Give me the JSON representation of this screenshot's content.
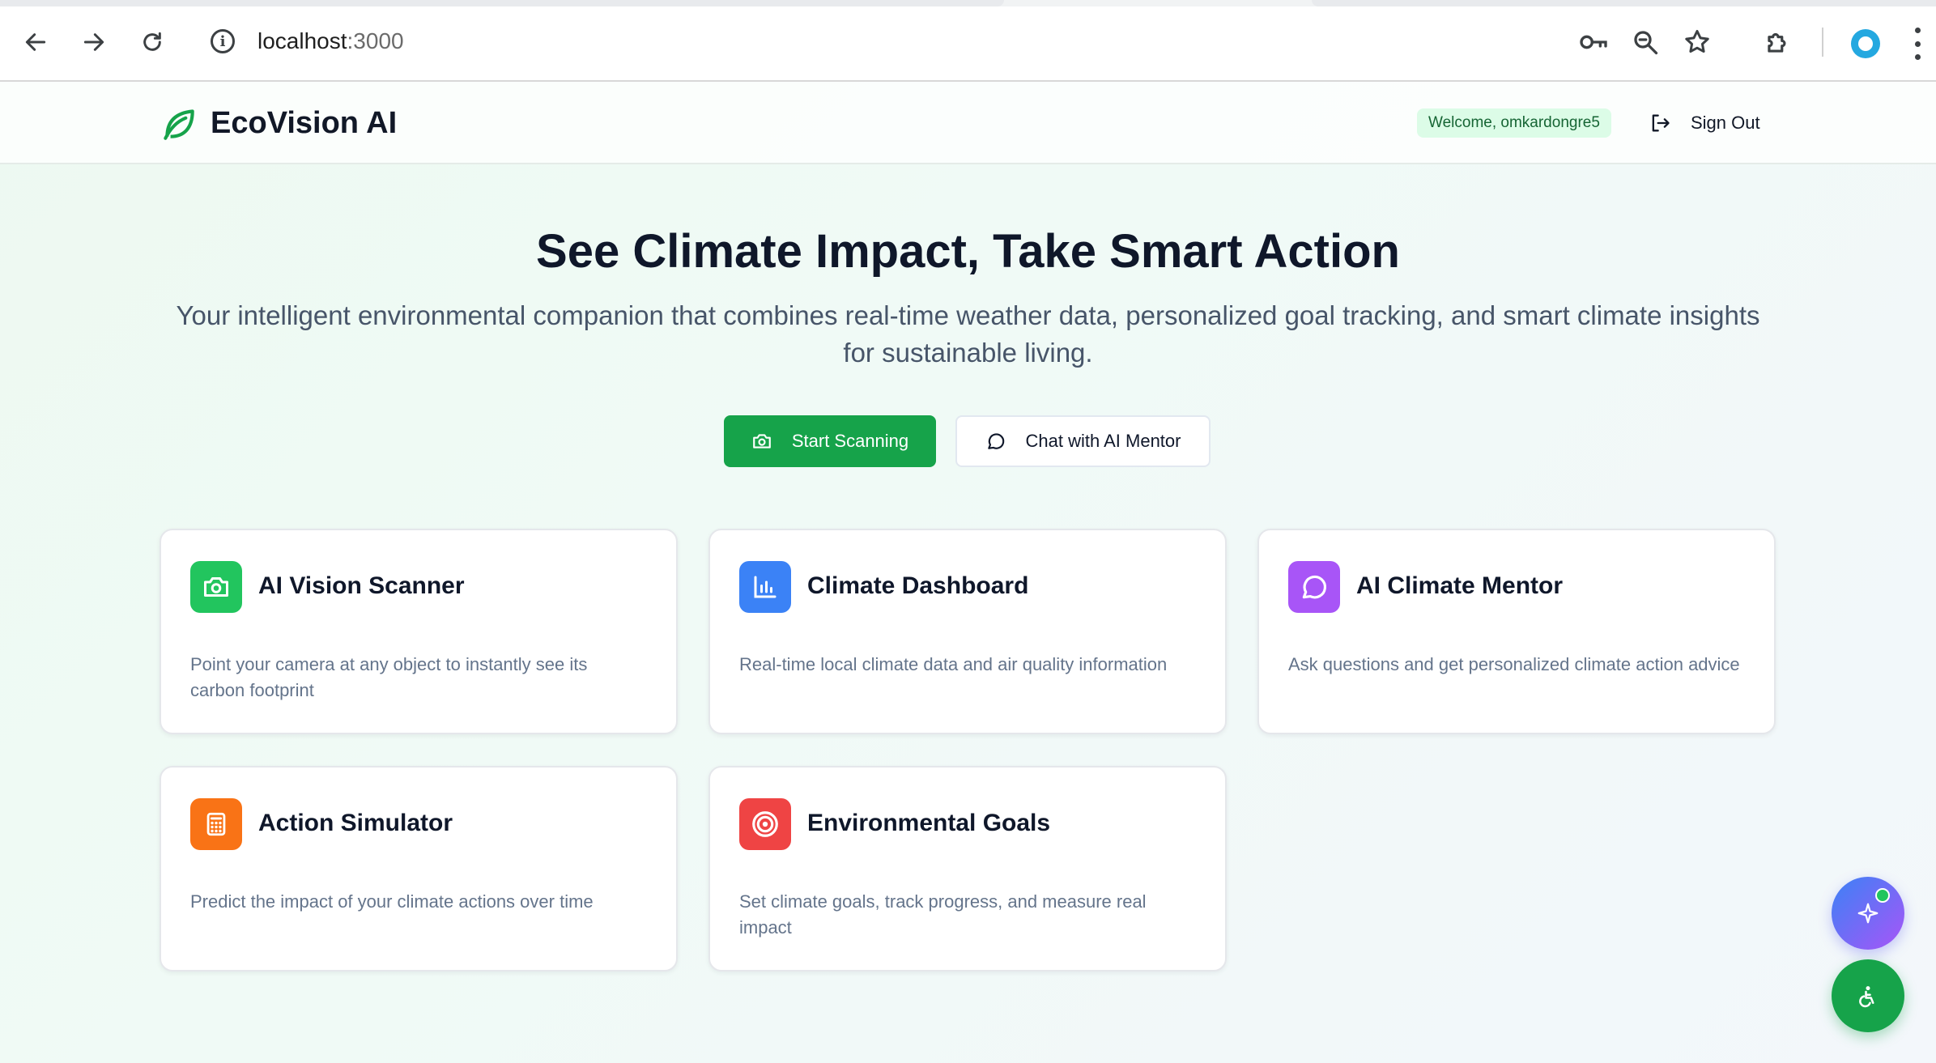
{
  "browser": {
    "url_host": "localhost",
    "url_port": ":3000",
    "icons": [
      "back-arrow-icon",
      "forward-arrow-icon",
      "reload-icon",
      "site-info-icon",
      "password-key-icon",
      "zoom-icon",
      "bookmark-star-icon",
      "extensions-icon",
      "profile-icon",
      "menu-icon"
    ]
  },
  "header": {
    "logo_text": "EcoVision AI",
    "welcome": "Welcome, omkardongre5",
    "signout_label": "Sign Out"
  },
  "hero": {
    "title": "See Climate Impact, Take Smart Action",
    "subtitle": "Your intelligent environmental companion that combines real-time weather data, personalized goal tracking, and smart climate insights for sustainable living.",
    "primary_button": "Start Scanning",
    "secondary_button": "Chat with AI Mentor"
  },
  "features": [
    {
      "title": "AI Vision Scanner",
      "description": "Point your camera at any object to instantly see its carbon footprint",
      "icon": "camera-icon",
      "color": "#22c55e"
    },
    {
      "title": "Climate Dashboard",
      "description": "Real-time local climate data and air quality information",
      "icon": "bar-chart-icon",
      "color": "#3b82f6"
    },
    {
      "title": "AI Climate Mentor",
      "description": "Ask questions and get personalized climate action advice",
      "icon": "chat-bubble-icon",
      "color": "#a855f7"
    },
    {
      "title": "Action Simulator",
      "description": "Predict the impact of your climate actions over time",
      "icon": "calculator-icon",
      "color": "#f97316"
    },
    {
      "title": "Environmental Goals",
      "description": "Set climate goals, track progress, and measure real impact",
      "icon": "target-icon",
      "color": "#ef4444"
    }
  ],
  "colors": {
    "brand_green": "#16a34a",
    "welcome_bg": "#dcfce7",
    "ai_fab_gradient": [
      "#3b82f6",
      "#a855f7"
    ]
  }
}
